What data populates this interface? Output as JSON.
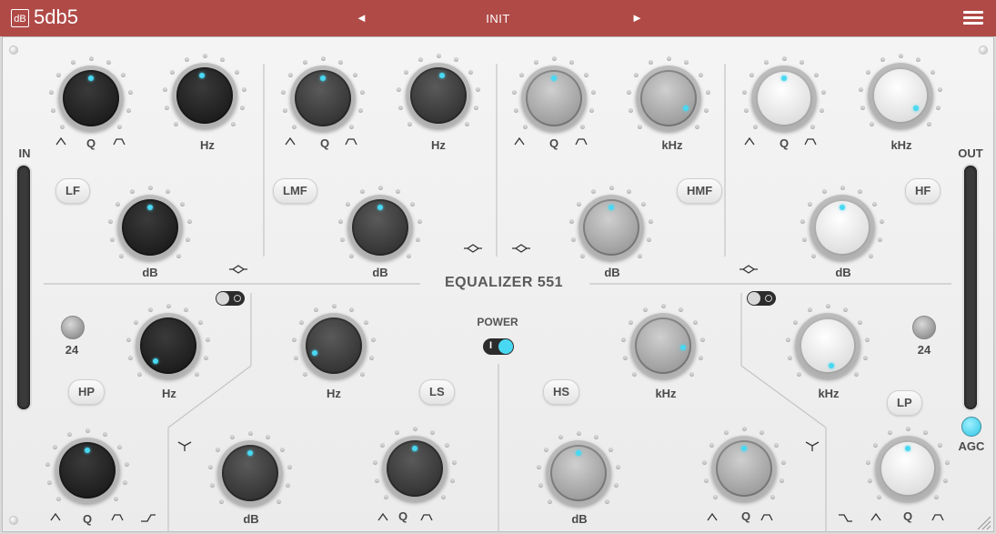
{
  "header": {
    "logo_badge": "dB",
    "brand": "5db5",
    "preset_name": "INIT",
    "prev_arrow": "◄",
    "next_arrow": "►",
    "menu_icon": "hamburger-menu-icon"
  },
  "title": "EQUALIZER  551",
  "power": {
    "label": "POWER",
    "on_glyph": "I",
    "state": "on"
  },
  "meters": {
    "in_label": "IN",
    "out_label": "OUT",
    "agc_label": "AGC"
  },
  "bands": {
    "lf": {
      "button": "LF",
      "q_label": "Q",
      "freq_label": "Hz",
      "gain_label": "dB"
    },
    "lmf": {
      "button": "LMF",
      "q_label": "Q",
      "freq_label": "Hz",
      "gain_label": "dB"
    },
    "hmf": {
      "button": "HMF",
      "q_label": "Q",
      "freq_label": "kHz",
      "gain_label": "dB"
    },
    "hf": {
      "button": "HF",
      "q_label": "Q",
      "freq_label": "kHz",
      "gain_label": "dB"
    },
    "hp": {
      "button": "HP",
      "slope": "24",
      "freq_label": "Hz",
      "q_label": "Q"
    },
    "ls": {
      "button": "LS",
      "freq_label": "Hz",
      "gain_label": "dB",
      "q_label": "Q"
    },
    "hs": {
      "button": "HS",
      "freq_label": "kHz",
      "gain_label": "dB",
      "q_label": "Q"
    },
    "lp": {
      "button": "LP",
      "slope": "24",
      "freq_label": "kHz",
      "q_label": "Q"
    }
  },
  "colors": {
    "header_bg": "#b04a47",
    "accent": "#49d8f2",
    "knob_black": "#1e1e1e",
    "knob_dark": "#3c3c3c",
    "knob_mid": "#9c9c9c",
    "knob_light": "#e6e6e6"
  }
}
